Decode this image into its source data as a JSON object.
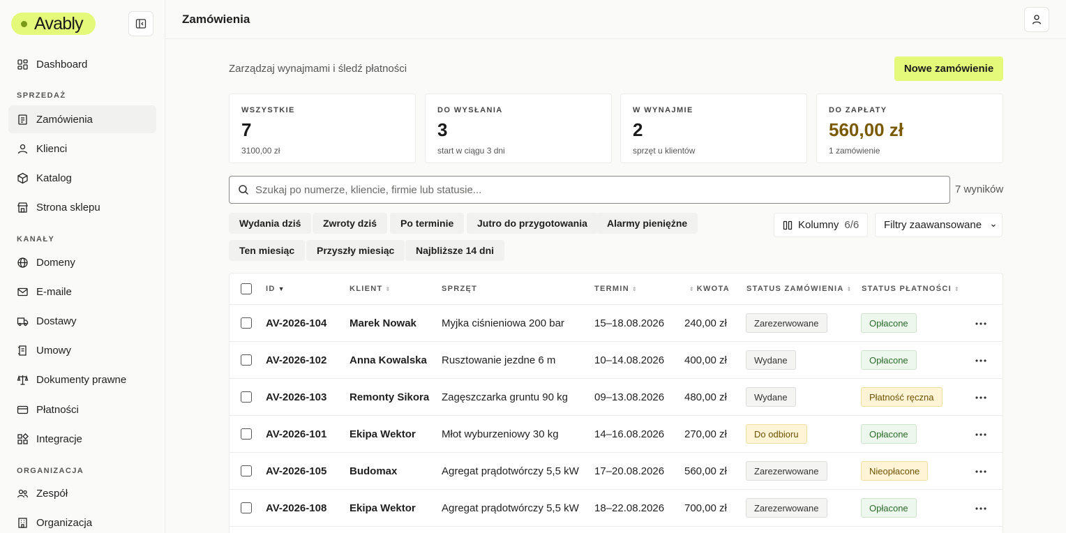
{
  "app": {
    "logo_text": "Avably"
  },
  "sidebar": {
    "top_item": {
      "label": "Dashboard",
      "icon": "dashboard-icon"
    },
    "sections": [
      {
        "title": "SPRZEDAŻ"
      },
      {
        "title": "KANAŁY"
      },
      {
        "title": "ORGANIZACJA"
      }
    ],
    "sales_items": [
      {
        "label": "Zamówienia",
        "icon": "orders-icon",
        "active": true
      },
      {
        "label": "Klienci",
        "icon": "user-icon"
      },
      {
        "label": "Katalog",
        "icon": "box-icon"
      },
      {
        "label": "Strona sklepu",
        "icon": "store-icon"
      }
    ],
    "channel_items": [
      {
        "label": "Domeny",
        "icon": "globe-icon"
      },
      {
        "label": "E-maile",
        "icon": "mail-icon"
      },
      {
        "label": "Dostawy",
        "icon": "truck-icon"
      },
      {
        "label": "Umowy",
        "icon": "contract-icon"
      },
      {
        "label": "Dokumenty prawne",
        "icon": "scale-icon"
      },
      {
        "label": "Płatności",
        "icon": "card-icon"
      },
      {
        "label": "Integracje",
        "icon": "integrations-icon"
      }
    ],
    "org_items": [
      {
        "label": "Zespół",
        "icon": "team-icon"
      },
      {
        "label": "Organizacja",
        "icon": "building-icon"
      }
    ]
  },
  "header": {
    "title": "Zamówienia"
  },
  "main": {
    "subtitle": "Zarządzaj wynajmami i śledź płatności",
    "new_order_label": "Nowe zamówienie",
    "stats": [
      {
        "label": "WSZYSTKIE",
        "value": "7",
        "sub": "3100,00 zł"
      },
      {
        "label": "DO WYSŁANIA",
        "value": "3",
        "sub": "start w ciągu 3 dni"
      },
      {
        "label": "W WYNAJMIE",
        "value": "2",
        "sub": "sprzęt u klientów"
      },
      {
        "label": "DO ZAPŁATY",
        "value": "560,00 zł",
        "sub": "1 zamówienie"
      }
    ],
    "search": {
      "placeholder": "Szukaj po numerze, kliencie, firmie lub statusie...",
      "value": ""
    },
    "results_count": "7 wyników",
    "quick_filters_row1": [
      "Wydania dziś",
      "Zwroty dziś",
      "Po terminie",
      "Jutro do przygotowania",
      "Alarmy pieniężne"
    ],
    "quick_filters_row2": [
      "Ten miesiąc",
      "Przyszły miesiąc",
      "Najbliższe 14 dni"
    ],
    "columns_button": {
      "label": "Kolumny",
      "count": "6/6"
    },
    "advanced_filters_label": "Filtry zaawansowane",
    "colors": {
      "accent": "#e4f87a",
      "money": "#7a5a00",
      "paid": "#2a6b2a",
      "warning": "#6e5100"
    }
  },
  "table": {
    "headers": [
      "ID",
      "KLIENT",
      "SPRZĘT",
      "TERMIN",
      "KWOTA",
      "STATUS ZAMÓWIENIA",
      "STATUS PŁATNOŚCI"
    ],
    "rows": [
      {
        "id": "AV-2026-104",
        "client": "Marek Nowak",
        "equipment": "Myjka ciśnieniowa 200 bar",
        "term": "15–18.08.2026",
        "amount": "240,00 zł",
        "order_status": "Zarezerwowane",
        "payment_status": "Opłacone"
      },
      {
        "id": "AV-2026-102",
        "client": "Anna Kowalska",
        "equipment": "Rusztowanie jezdne 6 m",
        "term": "10–14.08.2026",
        "amount": "400,00 zł",
        "order_status": "Wydane",
        "payment_status": "Opłacone"
      },
      {
        "id": "AV-2026-103",
        "client": "Remonty Sikora",
        "equipment": "Zagęszczarka gruntu 90 kg",
        "term": "09–13.08.2026",
        "amount": "480,00 zł",
        "order_status": "Wydane",
        "payment_status": "Płatność ręczna"
      },
      {
        "id": "AV-2026-101",
        "client": "Ekipa Wektor",
        "equipment": "Młot wyburzeniowy 30 kg",
        "term": "14–16.08.2026",
        "amount": "270,00 zł",
        "order_status": "Do odbioru",
        "payment_status": "Opłacone"
      },
      {
        "id": "AV-2026-105",
        "client": "Budomax",
        "equipment": "Agregat prądotwórczy 5,5 kW",
        "term": "17–20.08.2026",
        "amount": "560,00 zł",
        "order_status": "Zarezerwowane",
        "payment_status": "Nieopłacone"
      },
      {
        "id": "AV-2026-108",
        "client": "Ekipa Wektor",
        "equipment": "Agregat prądotwórczy 5,5 kW",
        "term": "18–22.08.2026",
        "amount": "700,00 zł",
        "order_status": "Zarezerwowane",
        "payment_status": "Opłacone"
      }
    ]
  }
}
